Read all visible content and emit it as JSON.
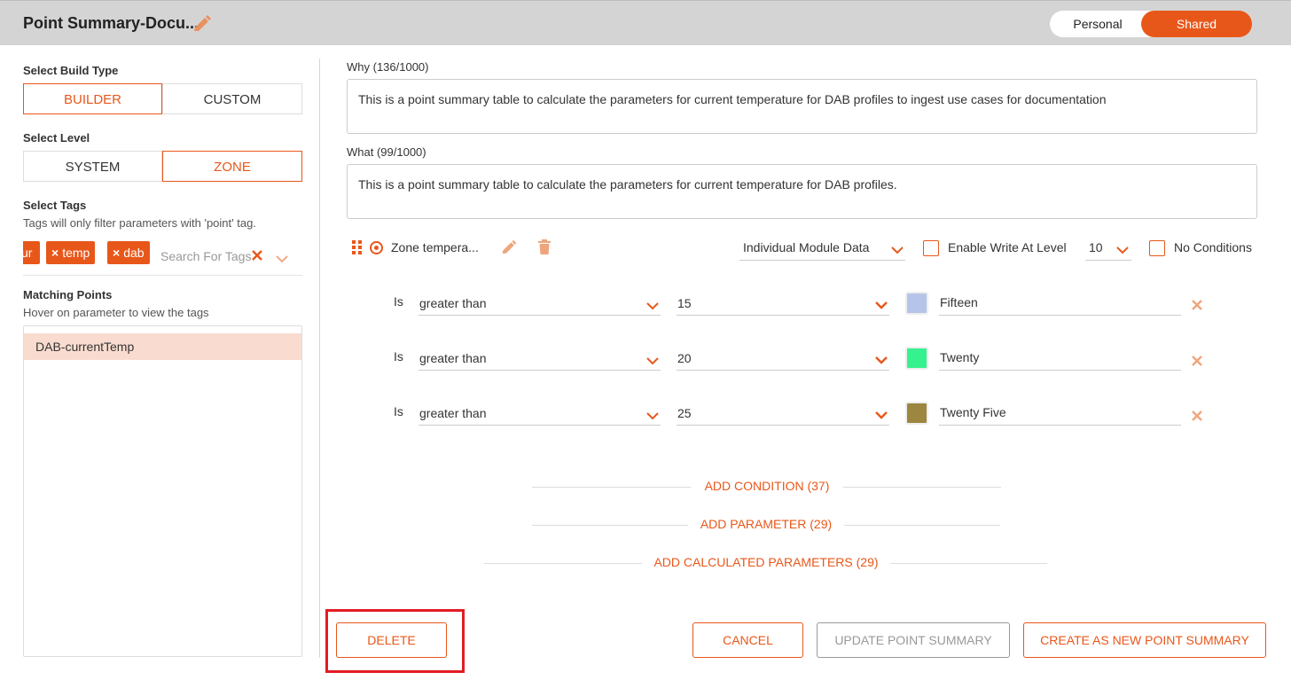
{
  "header": {
    "title": "Point Summary-Docu...",
    "toggle": {
      "personal": "Personal",
      "shared": "Shared",
      "selected": "Shared"
    }
  },
  "left": {
    "build_type_label": "Select Build Type",
    "build_types": [
      "BUILDER",
      "CUSTOM"
    ],
    "build_type_selected": "BUILDER",
    "level_label": "Select Level",
    "levels": [
      "SYSTEM",
      "ZONE"
    ],
    "level_selected": "ZONE",
    "tags_label": "Select Tags",
    "tags_hint": "Tags will only filter parameters with 'point' tag.",
    "tags": [
      "ur",
      "temp",
      "dab"
    ],
    "tags_search_placeholder": "Search For Tags",
    "matching_label": "Matching Points",
    "matching_hint": "Hover on parameter to view the tags",
    "matching_points": [
      "DAB-currentTemp"
    ]
  },
  "right": {
    "why_label": "Why (136/1000)",
    "why_text": "This is a point summary table to calculate the parameters for current temperature for DAB profiles to ingest use cases for documentation",
    "what_label": "What (99/1000)",
    "what_text": "This is a point summary table to calculate the parameters for current temperature for DAB profiles.",
    "parameter": {
      "name": "Zone tempera...",
      "data_source": "Individual Module Data",
      "enable_write_label": "Enable Write At Level",
      "write_level": "10",
      "no_conditions_label": "No Conditions"
    },
    "conditions": [
      {
        "is": "Is",
        "operator": "greater than",
        "value": "15",
        "color": "#b5c4e8",
        "label": "Fifteen"
      },
      {
        "is": "Is",
        "operator": "greater than",
        "value": "20",
        "color": "#35f28f",
        "label": "Twenty"
      },
      {
        "is": "Is",
        "operator": "greater than",
        "value": "25",
        "color": "#9c8640",
        "label": "Twenty Five"
      }
    ],
    "add_condition": "ADD CONDITION (37)",
    "add_parameter": "ADD PARAMETER (29)",
    "add_calculated": "ADD CALCULATED PARAMETERS (29)"
  },
  "footer": {
    "delete": "DELETE",
    "cancel": "CANCEL",
    "update": "UPDATE POINT SUMMARY",
    "create": "CREATE AS NEW POINT SUMMARY"
  },
  "colors": {
    "accent": "#e8571a",
    "highlight": "#e31b23"
  }
}
